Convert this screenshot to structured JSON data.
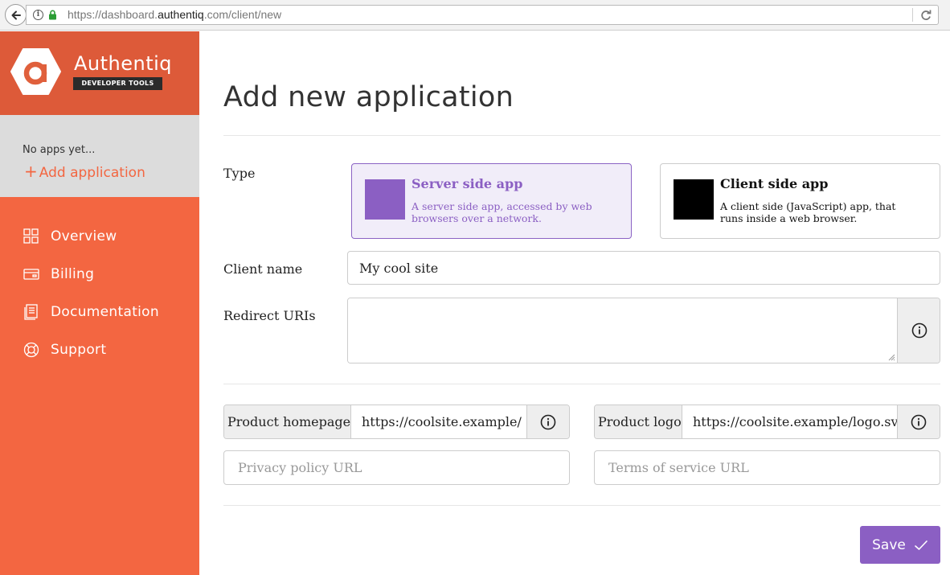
{
  "browser": {
    "url_prefix": "https://dashboard.",
    "url_domain": "authentiq",
    "url_suffix": ".com/client/new"
  },
  "sidebar": {
    "brand_name": "Authentiq",
    "brand_badge": "DEVELOPER TOOLS",
    "no_apps_text": "No apps yet...",
    "add_application_label": "Add application",
    "nav_items": [
      {
        "label": "Overview",
        "icon": "grid-icon"
      },
      {
        "label": "Billing",
        "icon": "credit-card-icon"
      },
      {
        "label": "Documentation",
        "icon": "document-icon"
      },
      {
        "label": "Support",
        "icon": "lifebuoy-icon"
      }
    ],
    "colors": {
      "header": "#dd5a39",
      "body": "#f36641",
      "apps_panel": "#dcdcdc"
    }
  },
  "form": {
    "title": "Add new application",
    "type_label": "Type",
    "types": [
      {
        "title": "Server side app",
        "description": "A server side app, accessed by web browsers over a network.",
        "selected": true,
        "swatch_color": "#8b5fc3"
      },
      {
        "title": "Client side app",
        "description": "A client side (JavaScript) app, that runs inside a web browser.",
        "selected": false,
        "swatch_color": "#000000"
      }
    ],
    "client_name_label": "Client name",
    "client_name_value": "My cool site",
    "redirect_uris_label": "Redirect URIs",
    "redirect_uris_value": "",
    "product_homepage_label": "Product homepage",
    "product_homepage_value": "https://coolsite.example/",
    "product_logo_label": "Product logo",
    "product_logo_value": "https://coolsite.example/logo.sv",
    "privacy_policy_placeholder": "Privacy policy URL",
    "terms_of_service_placeholder": "Terms of service URL",
    "save_label": "Save",
    "accent_color": "#8b5fc3"
  }
}
